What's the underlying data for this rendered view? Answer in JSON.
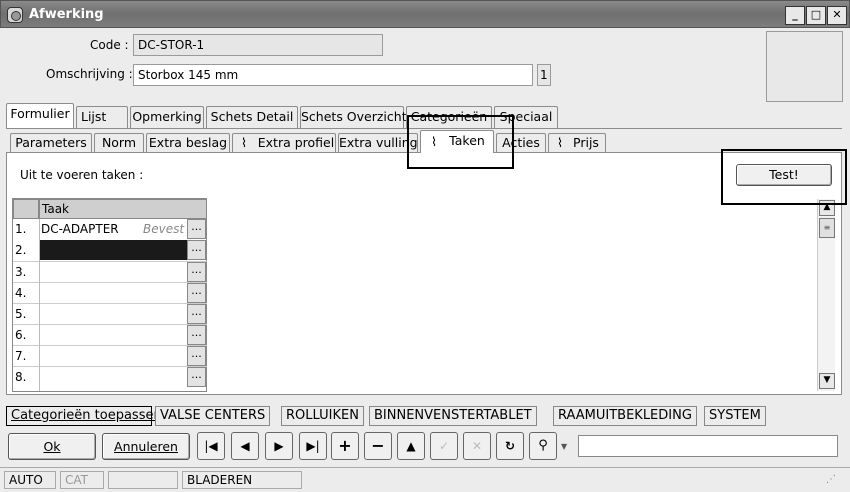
{
  "window": {
    "title": "Afwerking",
    "min": "_",
    "max": "□",
    "close": "✕"
  },
  "form": {
    "code_label": "Code :",
    "code_value": "DC-STOR-1",
    "desc_label": "Omschrijving :",
    "desc_value": "Storbox 145 mm",
    "desc_badge": "1"
  },
  "main_tabs": [
    "Formulier",
    "Lijst",
    "Opmerking",
    "Schets Detail",
    "Schets Overzicht",
    "Categorieën",
    "Speciaal"
  ],
  "sub_tabs": [
    "Parameters",
    "Norm",
    "Extra beslag",
    "Extra profiel",
    "Extra vulling",
    "Taken",
    "Acties",
    "Prijs"
  ],
  "panel": {
    "caption": "Uit te voeren taken :",
    "test_button": "Test!",
    "grid_header": "Taak",
    "rows": [
      {
        "num": "1.",
        "taak": "DC-ADAPTER",
        "extra": "Bevest"
      },
      {
        "num": "2.",
        "taak": "",
        "extra": ""
      },
      {
        "num": "3.",
        "taak": "",
        "extra": ""
      },
      {
        "num": "4.",
        "taak": "",
        "extra": ""
      },
      {
        "num": "5.",
        "taak": "",
        "extra": ""
      },
      {
        "num": "6.",
        "taak": "",
        "extra": ""
      },
      {
        "num": "7.",
        "taak": "",
        "extra": ""
      },
      {
        "num": "8.",
        "taak": "",
        "extra": ""
      }
    ],
    "dots": "..."
  },
  "categories": [
    "Categorieën toepassen",
    "VALSE CENTERS",
    "ROLLUIKEN",
    "BINNENVENSTERTABLET",
    "RAAMUITBEKLEDING",
    "SYSTEM"
  ],
  "actions": {
    "ok": "Ok",
    "cancel": "Annuleren"
  },
  "status": {
    "mode": "AUTO",
    "cat": "CAT",
    "state": "BLADEREN"
  }
}
